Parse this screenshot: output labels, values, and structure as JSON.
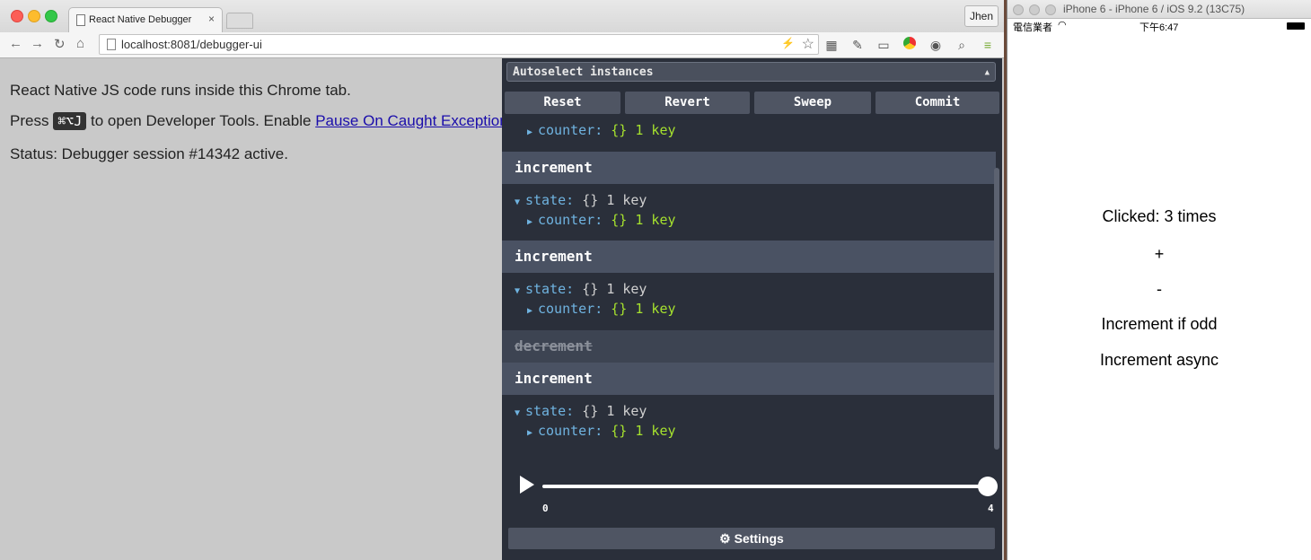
{
  "browser": {
    "tab_title": "React Native Debugger",
    "tab_close": "×",
    "profile_name": "Jhen",
    "url": "localhost:8081/debugger-ui",
    "nav": {
      "back": "←",
      "forward": "→",
      "reload": "↻",
      "home": "⌂"
    },
    "extensions": [
      "bolt-icon",
      "star-icon",
      "ext-a",
      "ext-b",
      "cast-icon",
      "chrome-icon",
      "pocket-icon",
      "zoom-icon",
      "menu-icon"
    ]
  },
  "page": {
    "line1": "React Native JS code runs inside this Chrome tab.",
    "line2_prefix": "Press",
    "line2_kbd": "⌘⌥J",
    "line2_middle": "to open Developer Tools. Enable",
    "line2_link": "Pause On Caught Exceptions",
    "line3": "Status: Debugger session #14342 active."
  },
  "devtools": {
    "instance_select": "Autoselect instances",
    "buttons": {
      "reset": "Reset",
      "revert": "Revert",
      "sweep": "Sweep",
      "commit": "Commit"
    },
    "entries": [
      {
        "action": null,
        "state_key": null,
        "child_key": "counter:",
        "child_val": "{}",
        "child_count": "1 key"
      },
      {
        "action": "increment",
        "skipped": false,
        "state_key": "state:",
        "state_val": "{}",
        "state_count": "1 key",
        "child_key": "counter:",
        "child_val": "{}",
        "child_count": "1 key"
      },
      {
        "action": "increment",
        "skipped": false,
        "state_key": "state:",
        "state_val": "{}",
        "state_count": "1 key",
        "child_key": "counter:",
        "child_val": "{}",
        "child_count": "1 key"
      },
      {
        "action": "decrement",
        "skipped": true
      },
      {
        "action": "increment",
        "skipped": false,
        "state_key": "state:",
        "state_val": "{}",
        "state_count": "1 key",
        "child_key": "counter:",
        "child_val": "{}",
        "child_count": "1 key"
      }
    ],
    "slider": {
      "min_label": "0",
      "max_label": "4",
      "value": 4
    },
    "settings_label": "Settings",
    "settings_icon": "⚙"
  },
  "simulator": {
    "title": "iPhone 6 - iPhone 6 / iOS 9.2 (13C75)",
    "carrier": "電信業者",
    "time": "下午6:47",
    "clicked_text": "Clicked: 3 times",
    "plus": "+",
    "minus": "-",
    "increment_if_odd": "Increment if odd",
    "increment_async": "Increment async"
  }
}
